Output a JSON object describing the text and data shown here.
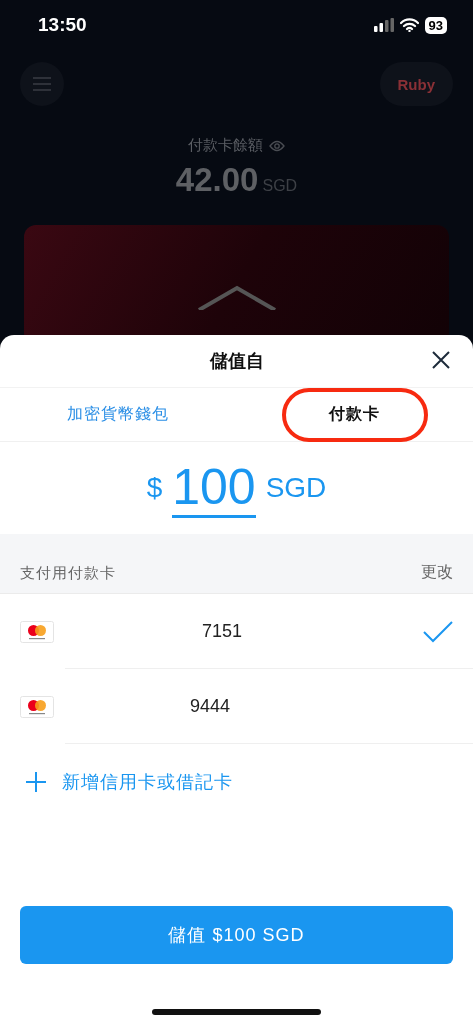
{
  "status_bar": {
    "time": "13:50",
    "battery": "93"
  },
  "header": {
    "profile": "Ruby"
  },
  "balance": {
    "label": "付款卡餘額",
    "amount": "42.00",
    "currency": "SGD"
  },
  "sheet": {
    "title": "儲值自",
    "tabs": [
      {
        "label": "加密貨幣錢包",
        "selected": false,
        "circled": false
      },
      {
        "label": "付款卡",
        "selected": true,
        "circled": true
      }
    ],
    "amount": {
      "symbol": "$",
      "value": "100",
      "currency": "SGD"
    },
    "section": {
      "title": "支付用付款卡",
      "action": "更改"
    },
    "cards": [
      {
        "number": "7151",
        "selected": true
      },
      {
        "number": "9444",
        "selected": false
      }
    ],
    "add_card": "新增信用卡或借記卡",
    "submit": "儲值 $100 SGD"
  }
}
